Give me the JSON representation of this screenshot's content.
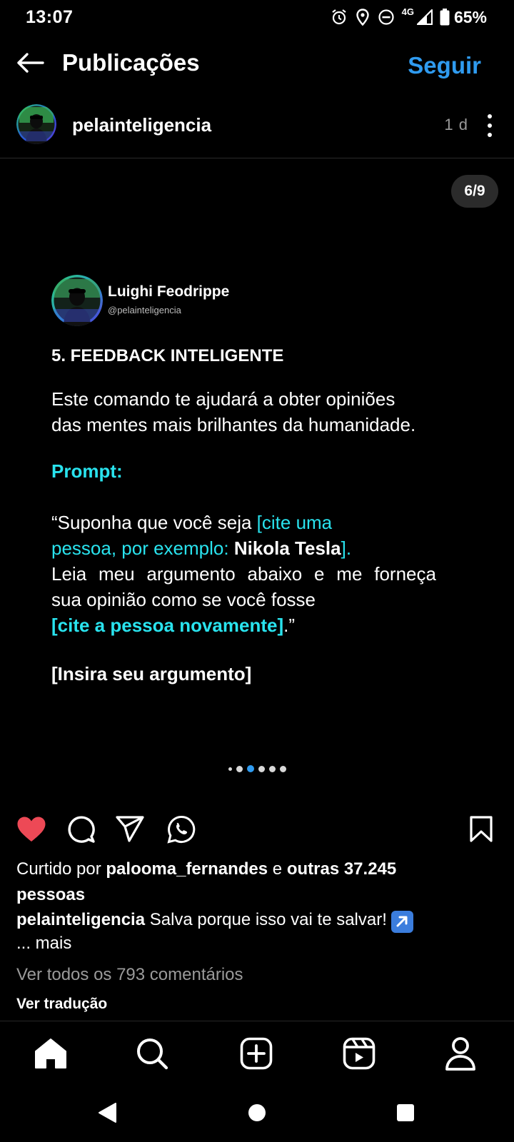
{
  "status_bar": {
    "time": "13:07",
    "network": "4G",
    "battery": "65%",
    "icons": [
      "alarm-icon",
      "location-icon",
      "do-not-disturb-icon",
      "signal-icon",
      "battery-icon"
    ]
  },
  "header": {
    "title": "Publicações",
    "follow_label": "Seguir",
    "back_icon": "arrow-left-icon",
    "accent_color": "#2f9bf0"
  },
  "author": {
    "username": "pelainteligencia",
    "age": "1 d"
  },
  "media": {
    "page_counter": "6/9",
    "card": {
      "author_name": "Luighi Feodrippe",
      "author_handle": "@pelainteligencia",
      "heading": "5. FEEDBACK INTELIGENTE",
      "body_lines": [
        "Este comando te ajudará a obter opiniões",
        "das mentes mais brilhantes da humanidade."
      ],
      "prompt_label": "Prompt:",
      "prompt": {
        "l1_plain": "“Suponha que você seja ",
        "l1_cyan": "[cite uma",
        "l2_cyan": "pessoa, por exemplo: ",
        "l2_bold": "Nikola Tesla",
        "l2_end": "].",
        "l3_words": [
          "Leia",
          "meu",
          "argumento",
          "abaixo",
          "e",
          "me",
          "forneça"
        ],
        "l4": "sua opinião como se você fosse",
        "l5_cyan": "[cite a pessoa novamente]",
        "l5_end": ".”"
      },
      "insert_label": "[Insira seu argumento]",
      "highlight_color": "#29e3ee"
    },
    "dots": {
      "count": 5,
      "active_index": 1
    }
  },
  "actions": {
    "liked": true,
    "like_color": "#ed4956",
    "icons": [
      "heart-icon",
      "comment-icon",
      "share-icon",
      "whatsapp-icon",
      "bookmark-icon"
    ]
  },
  "likes": {
    "prefix": "Curtido por ",
    "user": "palooma_fernandes",
    "middle": " e ",
    "others": "outras 37.245",
    "suffix": "pessoas"
  },
  "caption": {
    "user": "pelainteligencia",
    "text": " Salva porque isso vai te salvar!",
    "more": "... mais"
  },
  "comments": {
    "view_all": "Ver todos os 793 comentários"
  },
  "translate": "Ver tradução",
  "bottom_nav": [
    "home-icon",
    "search-icon",
    "new-post-icon",
    "reels-icon",
    "profile-icon"
  ],
  "system_nav": [
    "back-icon",
    "home-icon",
    "recents-icon"
  ]
}
